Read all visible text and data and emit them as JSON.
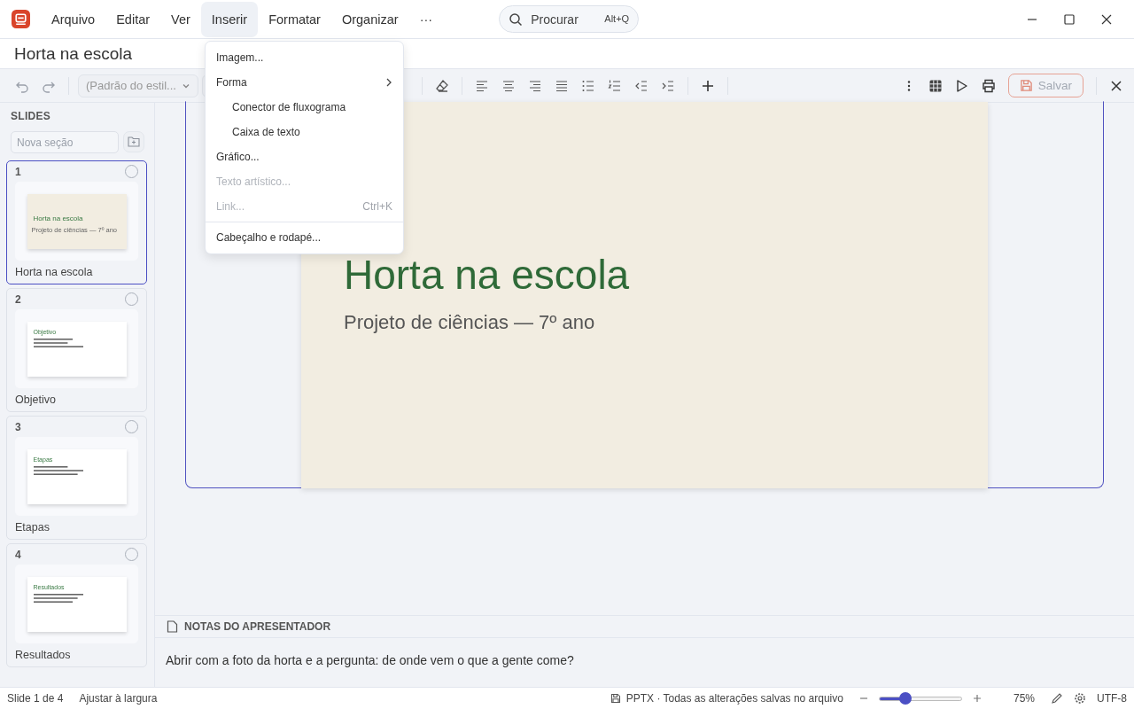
{
  "menu_bar": {
    "items": [
      {
        "label": "Arquivo",
        "selected": false
      },
      {
        "label": "Editar",
        "selected": false
      },
      {
        "label": "Ver",
        "selected": false
      },
      {
        "label": "Inserir",
        "selected": true
      },
      {
        "label": "Formatar",
        "selected": false
      },
      {
        "label": "Organizar",
        "selected": false
      },
      {
        "label": "···",
        "selected": false
      }
    ]
  },
  "search": {
    "placeholder": "Procurar",
    "shortcut": "Alt+Q"
  },
  "document_title": "Horta na escola",
  "toolbar": {
    "style_dropdown": "(Padrão do estil...",
    "save_button": {
      "label": "Salvar",
      "disabled": true
    }
  },
  "insert_menu": [
    {
      "label": "Imagem...",
      "disabled": false
    },
    {
      "label": "Forma",
      "disabled": false,
      "children": [
        {
          "label": "Conector de fluxograma",
          "disabled": false
        },
        {
          "label": "Caixa de texto",
          "disabled": false
        }
      ]
    },
    {
      "label": "Gráfico...",
      "disabled": false
    },
    {
      "label": "Texto artístico...",
      "disabled": true
    },
    {
      "label": "Link...",
      "disabled": true,
      "shortcut": "Ctrl+K"
    },
    {
      "label": "Cabeçalho e rodapé...",
      "disabled": false,
      "divider_before": true
    }
  ],
  "sidebar": {
    "heading": "SLIDES",
    "section_placeholder": "Nova seção",
    "slides": [
      {
        "number": "1",
        "title": "Horta na escola",
        "selected": true,
        "kind": "title",
        "thumb_title": "Horta na escola",
        "thumb_subtitle": "Projeto de ciências — 7º ano"
      },
      {
        "number": "2",
        "title": "Objetivo",
        "selected": false,
        "kind": "content",
        "thumb_title": "Objetivo"
      },
      {
        "number": "3",
        "title": "Etapas",
        "selected": false,
        "kind": "content",
        "thumb_title": "Etapas"
      },
      {
        "number": "4",
        "title": "Resultados",
        "selected": false,
        "kind": "content",
        "thumb_title": "Resultados"
      }
    ]
  },
  "slide": {
    "title": "Horta na escola",
    "subtitle": "Projeto de ciências — 7º ano"
  },
  "notes": {
    "heading": "NOTAS DO APRESENTADOR",
    "text": "Abrir com a foto da horta e a pergunta: de onde vem o que a gente come?"
  },
  "status_bar": {
    "position": "Slide 1 de 4",
    "fit": "Ajustar à largura",
    "file_status": "PPTX · Todas as alterações salvas no arquivo",
    "zoom": {
      "level": 0.32,
      "reading": "75%"
    },
    "encoding": "UTF-8"
  }
}
